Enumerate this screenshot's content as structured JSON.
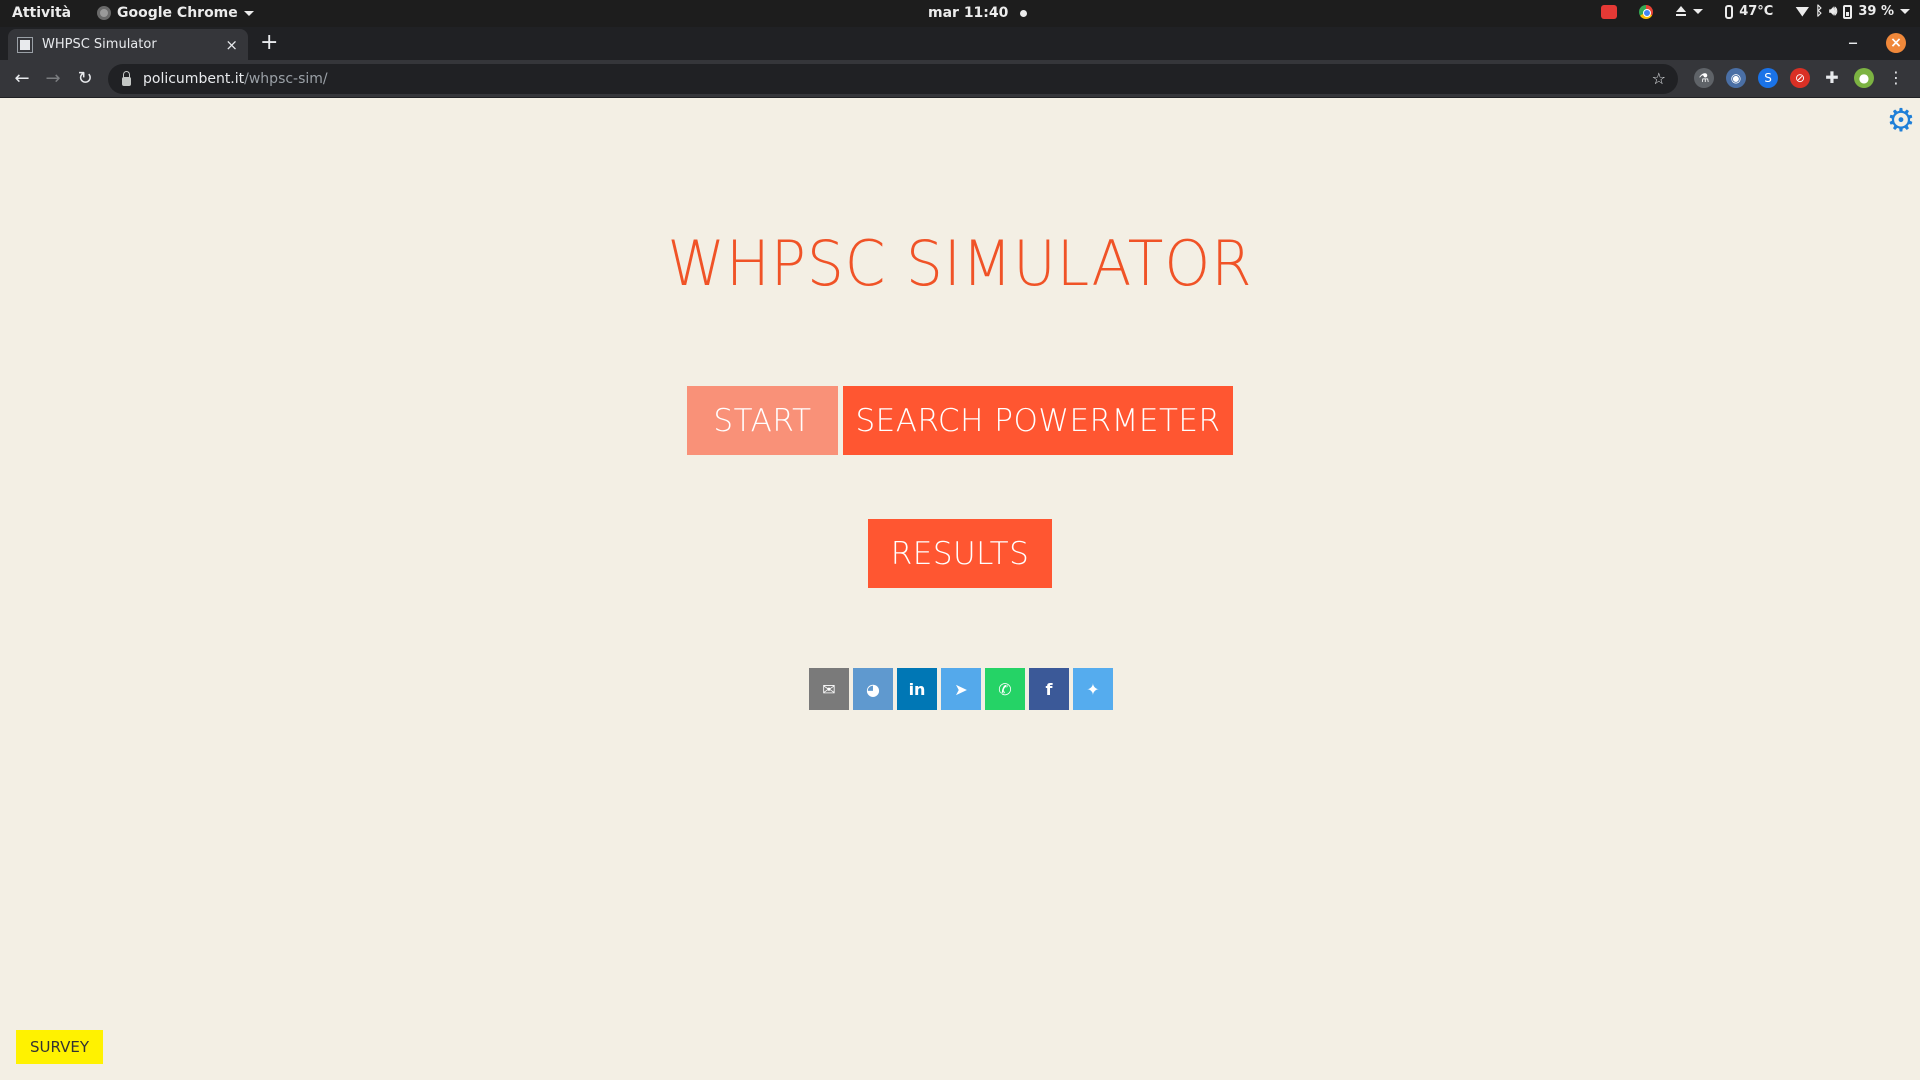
{
  "os_bar": {
    "activities": "Attività",
    "app_name": "Google Chrome",
    "clock": "mar 11:40",
    "temperature": "47°C",
    "battery": "39 %"
  },
  "browser": {
    "tab_title": "WHPSC Simulator",
    "tab_close": "×",
    "new_tab": "+",
    "minimize": "–",
    "close": "×",
    "url_host": "policumbent.it",
    "url_path": "/whpsc-sim/"
  },
  "page": {
    "title": "WHPSC SIMULATOR",
    "start_label": "START",
    "search_label": "SEARCH POWERMETER",
    "results_label": "RESULTS",
    "survey_label": "SURVEY",
    "share": [
      {
        "name": "email-icon",
        "glyph": "✉",
        "color": "#7a7a7a"
      },
      {
        "name": "reddit-icon",
        "glyph": "◕",
        "color": "#5f99cf"
      },
      {
        "name": "linkedin-icon",
        "glyph": "in",
        "color": "#0077b5"
      },
      {
        "name": "telegram-icon",
        "glyph": "➤",
        "color": "#54a9eb"
      },
      {
        "name": "whatsapp-icon",
        "glyph": "✆",
        "color": "#25d366"
      },
      {
        "name": "facebook-icon",
        "glyph": "f",
        "color": "#3b5998"
      },
      {
        "name": "twitter-icon",
        "glyph": "✦",
        "color": "#55acee"
      }
    ]
  },
  "colors": {
    "accent": "#ff5631",
    "accent_light": "#f99178",
    "background": "#f3efe4",
    "survey": "#fff200",
    "gear": "#1e7fd8"
  }
}
